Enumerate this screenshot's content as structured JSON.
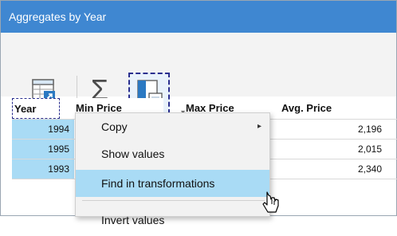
{
  "window": {
    "title": "Aggregates by Year"
  },
  "toolbar": {
    "buttons": [
      {
        "icon": "export-table-icon"
      },
      {
        "icon": "sigma-icon",
        "glyph": "Σ"
      },
      {
        "icon": "selection-view-icon",
        "selected": true
      }
    ],
    "overflow_glyph": "▾"
  },
  "grid": {
    "columns": [
      "Year",
      "Min Price",
      "Max Price",
      "Avg. Price"
    ],
    "rows": [
      {
        "year": "1994",
        "avg": "2,196"
      },
      {
        "year": "1995",
        "avg": "2,015"
      },
      {
        "year": "1993",
        "avg": "2,340"
      }
    ]
  },
  "context_menu": {
    "items": [
      {
        "label": "Copy",
        "has_submenu": true,
        "submenu_glyph": "▸"
      },
      {
        "label": "Show values"
      },
      {
        "label": "Find in transformations",
        "highlighted": true
      },
      {
        "label": "Invert values"
      }
    ]
  },
  "colors": {
    "titlebar": "#3f87d1",
    "selection": "#a9dbf5",
    "menu_bg": "#f2f2f2"
  }
}
